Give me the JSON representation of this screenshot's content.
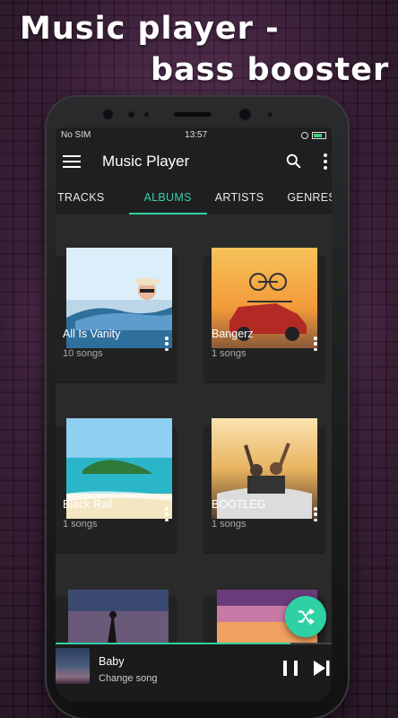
{
  "promo": {
    "line1": "Music player -",
    "line2": "bass booster"
  },
  "status": {
    "carrier": "No SIM",
    "time": "13:57"
  },
  "appbar": {
    "title": "Music Player"
  },
  "tabs": [
    {
      "label": "TRACKS",
      "active": false
    },
    {
      "label": "ALBUMS",
      "active": true
    },
    {
      "label": "ARTISTS",
      "active": false
    },
    {
      "label": "GENRES",
      "active": false
    }
  ],
  "albums": [
    {
      "title": "All Is Vanity",
      "count": "10 songs"
    },
    {
      "title": "Bangerz",
      "count": "1 songs"
    },
    {
      "title": "Black Rail",
      "count": "1 songs"
    },
    {
      "title": "BOOTLEG",
      "count": "1 songs"
    }
  ],
  "nowplaying": {
    "title": "Baby",
    "subtitle": "Change song",
    "progress": 0.85
  },
  "colors": {
    "accent": "#34d1a8",
    "surface": "#2a2a2a",
    "bar": "#1f1f1f"
  },
  "icons": {
    "menu": "hamburger-icon",
    "search": "search-icon",
    "overflow": "more-vertical-icon",
    "shuffle": "shuffle-icon",
    "pause": "pause-icon",
    "next": "skip-next-icon"
  }
}
